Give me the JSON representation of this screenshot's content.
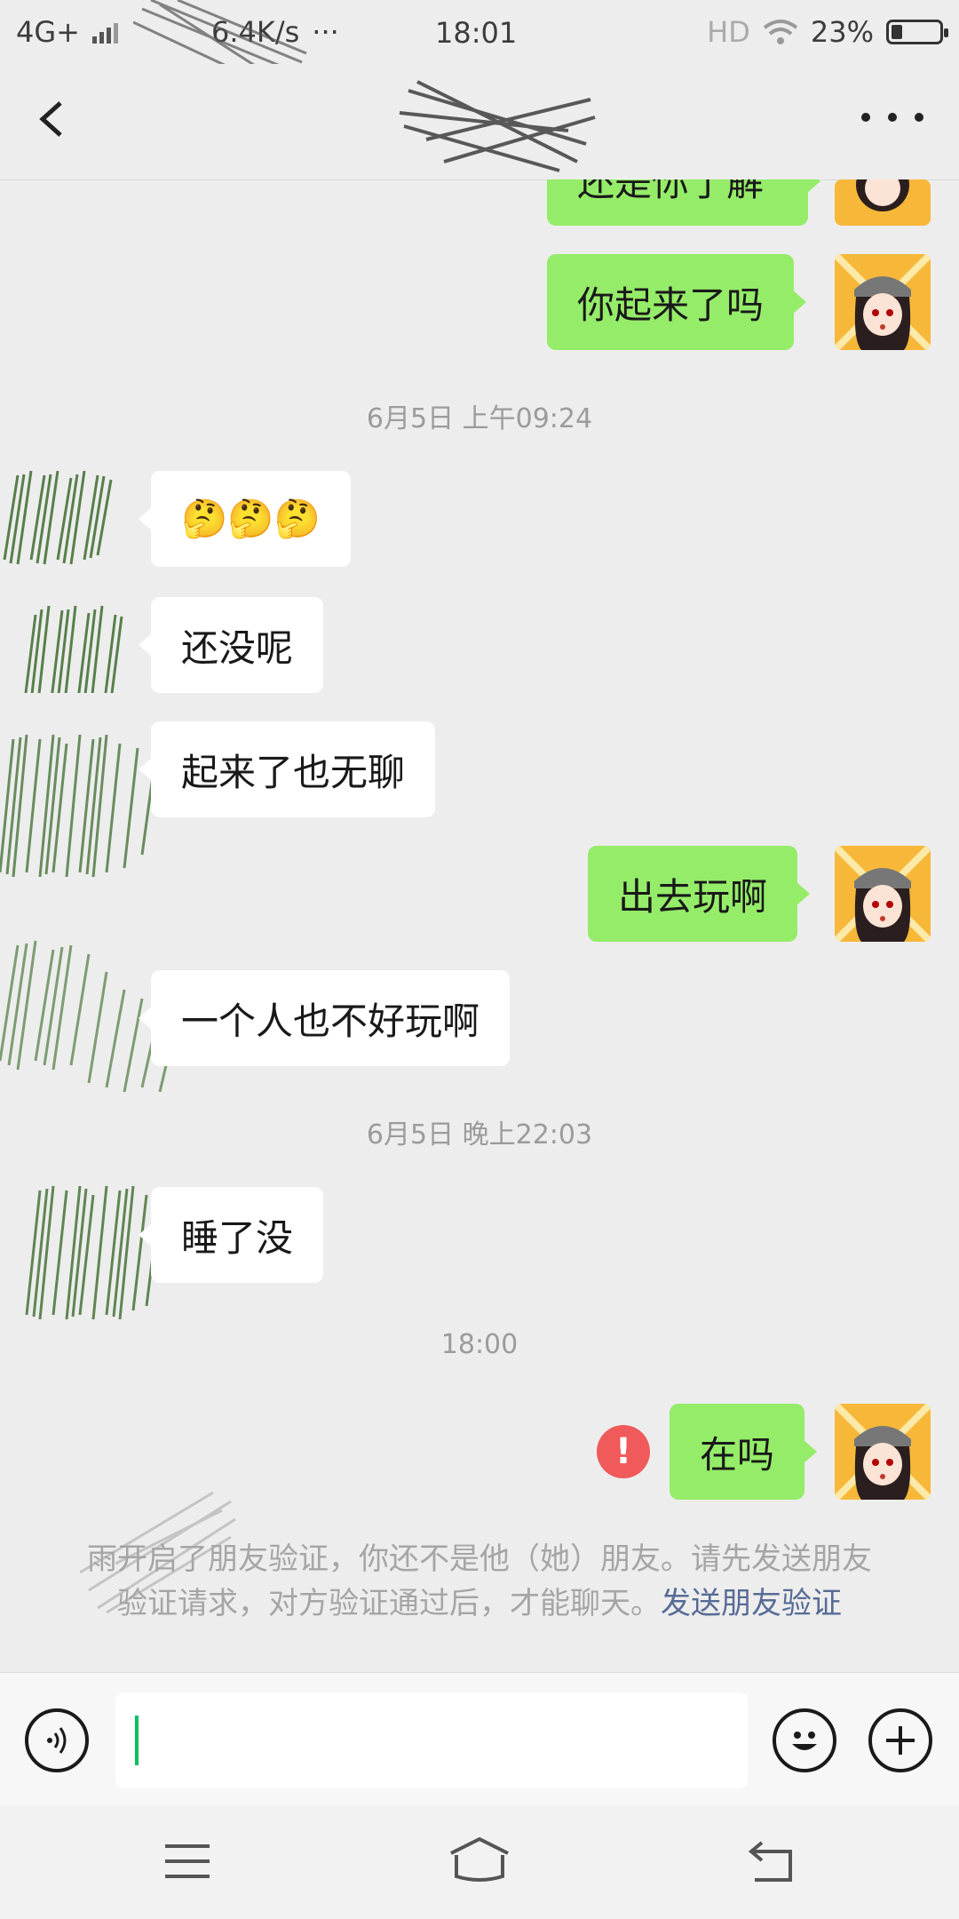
{
  "status_bar": {
    "network": "4G+",
    "speed": "6.4K/s",
    "dots": "···",
    "time": "18:01",
    "hd": "HD",
    "battery_percent_text": "23%",
    "battery_level": 0.23
  },
  "header": {
    "title": "",
    "back_icon": "chevron-left-icon",
    "more_icon": "more-dots-icon"
  },
  "messages": {
    "partial_top": "还是你了解",
    "m1": "你起来了吗",
    "time1": "6月5日 上午09:24",
    "m2_emoji": "🤔🤔🤔",
    "m3": "还没呢",
    "m4": "起来了也无聊",
    "m5": "出去玩啊",
    "m6": "一个人也不好玩啊",
    "time2": "6月5日 晚上22:03",
    "m7": "睡了没",
    "time3": "18:00",
    "m8": "在吗",
    "error_mark": "!"
  },
  "system_note": {
    "text": "雨开启了朋友验证，你还不是他（她）朋友。请先发送朋友验证请求，对方验证通过后，才能聊天。",
    "link": "发送朋友验证"
  },
  "input_bar": {
    "voice_icon": "voice-icon",
    "emoji_icon": "emoji-icon",
    "plus_icon": "plus-icon",
    "text": ""
  },
  "nav_bar": {
    "menu_icon": "menu-icon",
    "home_icon": "home-icon",
    "back_icon": "back-icon"
  }
}
